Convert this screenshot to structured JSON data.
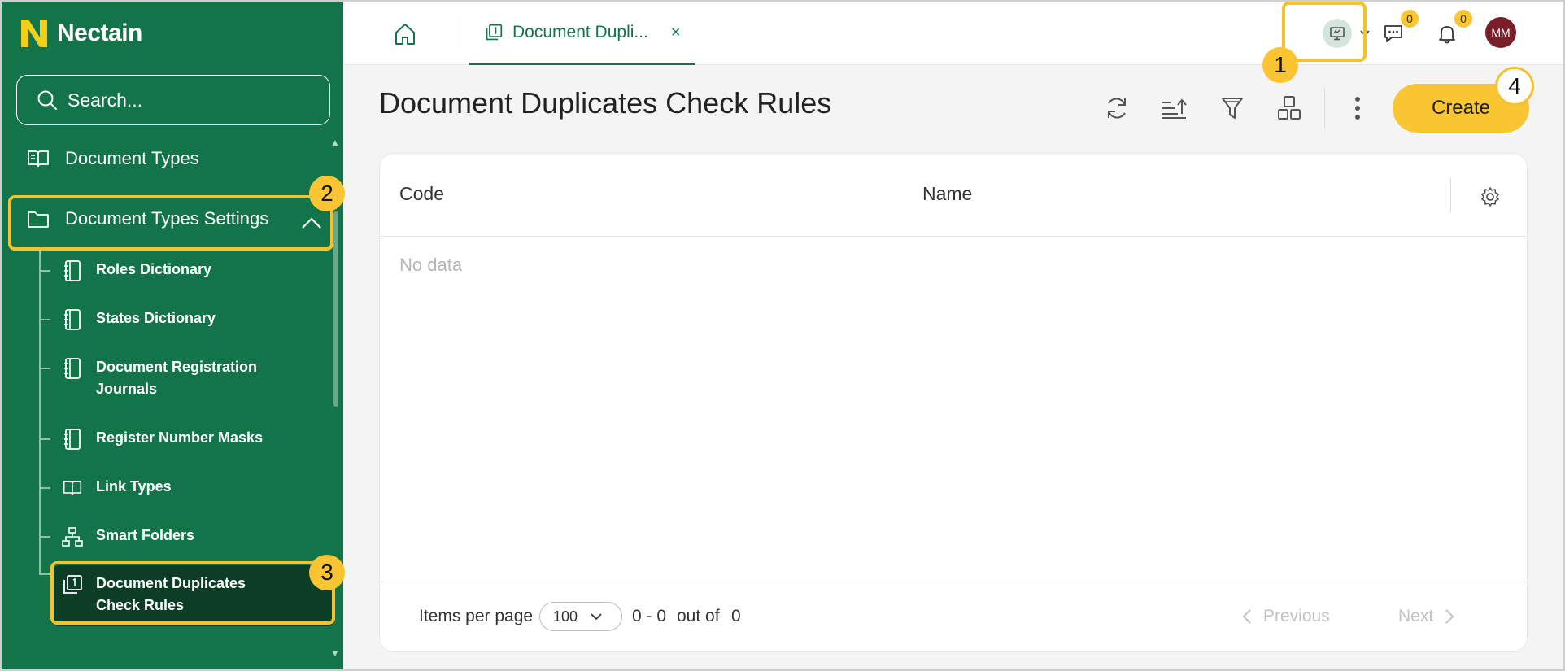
{
  "app": {
    "name": "Nectain",
    "logo_letter": "N",
    "accent": "#13744a",
    "highlight": "#f3c22e"
  },
  "search": {
    "placeholder": "Search..."
  },
  "sidebar": {
    "items": [
      {
        "label": "Document Types",
        "icon": "book-icon"
      },
      {
        "label": "Document Types Settings",
        "icon": "folder-icon",
        "expanded": true
      }
    ],
    "subitems": [
      {
        "label": "Roles Dictionary",
        "icon": "notebook-icon"
      },
      {
        "label": "States Dictionary",
        "icon": "notebook-icon"
      },
      {
        "label": "Document Registration Journals",
        "icon": "notebook-icon"
      },
      {
        "label": "Register Number Masks",
        "icon": "notebook-icon"
      },
      {
        "label": "Link Types",
        "icon": "book-icon"
      },
      {
        "label": "Smart Folders",
        "icon": "sitemap-icon"
      },
      {
        "label": "Document Duplicates Check Rules",
        "icon": "duplicate-icon",
        "active": true
      }
    ]
  },
  "callouts": [
    "1",
    "2",
    "3",
    "4"
  ],
  "tabs": [
    {
      "label": "Document Dupli...",
      "close": "×"
    }
  ],
  "header": {
    "messages_count": "0",
    "notifications_count": "0",
    "avatar_initials": "MM"
  },
  "main": {
    "title": "Document Duplicates Check Rules",
    "create_label": "Create",
    "columns": [
      "Code",
      "Name"
    ],
    "empty_text": "No data"
  },
  "footer": {
    "items_per_page_label": "Items per page",
    "items_per_page_value": "100",
    "range": "0 - 0",
    "out_of_label": "out of",
    "total": "0",
    "previous_label": "Previous",
    "next_label": "Next"
  }
}
